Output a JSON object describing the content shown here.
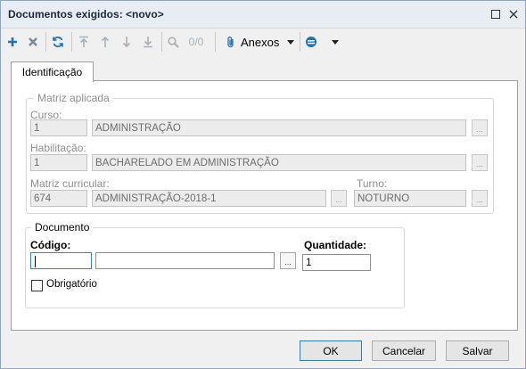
{
  "window": {
    "title": "Documentos exigidos: <novo>",
    "maximize_icon": "maximize-icon",
    "close_icon": "close-icon"
  },
  "toolbar": {
    "page_indicator": "0/0",
    "attachments_label": "Anexos",
    "accent_color": "#1f73b7"
  },
  "tabs": [
    {
      "label": "Identificação"
    }
  ],
  "matriz": {
    "legend": "Matriz aplicada",
    "curso_label": "Curso:",
    "curso_code": "1",
    "curso_name": "ADMINISTRAÇÃO",
    "habilitacao_label": "Habilitação:",
    "habilitacao_code": "1",
    "habilitacao_name": "BACHARELADO EM ADMINISTRAÇÃO",
    "matriz_label": "Matriz curricular:",
    "matriz_code": "674",
    "matriz_name": "ADMINISTRAÇÃO-2018-1",
    "turno_label": "Turno:",
    "turno_value": "NOTURNO"
  },
  "documento": {
    "legend": "Documento",
    "codigo_label": "Código:",
    "codigo_value": "",
    "descricao_value": "",
    "quantidade_label": "Quantidade:",
    "quantidade_value": "1",
    "obrigatorio_label": "Obrigatório",
    "obrigatorio_checked": false
  },
  "buttons": {
    "ok": "OK",
    "cancel": "Cancelar",
    "save": "Salvar"
  },
  "lookup_button_label": "..."
}
